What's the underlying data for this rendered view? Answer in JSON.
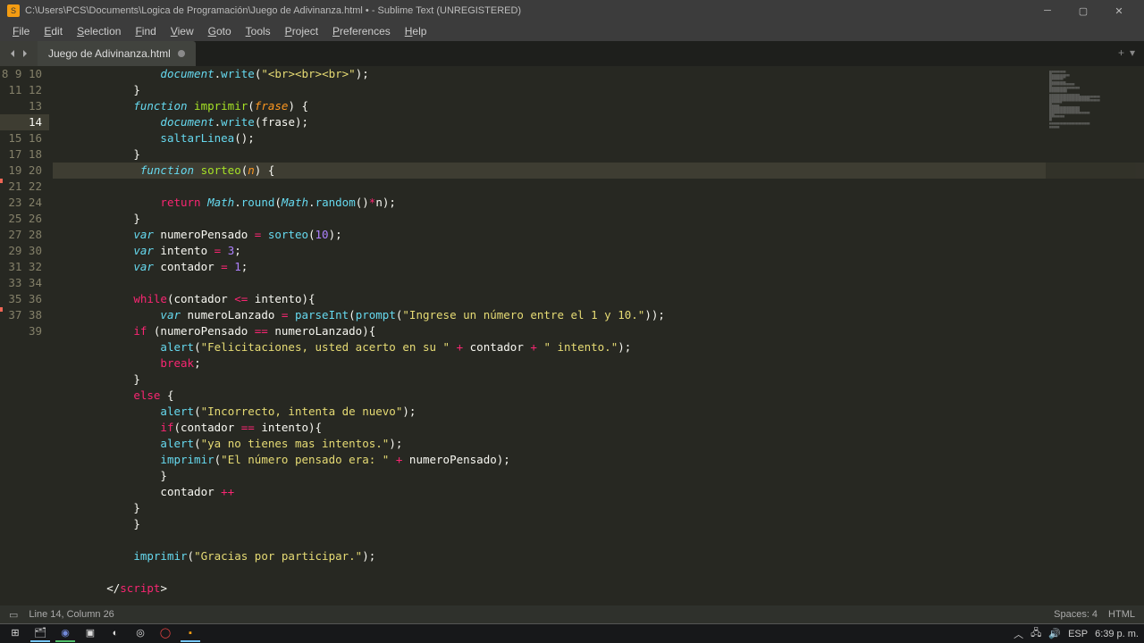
{
  "window": {
    "title": "C:\\Users\\PCS\\Documents\\Logica de Programación\\Juego de Adivinanza.html • - Sublime Text (UNREGISTERED)"
  },
  "menu": {
    "items": [
      "File",
      "Edit",
      "Selection",
      "Find",
      "View",
      "Goto",
      "Tools",
      "Project",
      "Preferences",
      "Help"
    ]
  },
  "tab": {
    "title": "Juego de Adivinanza.html"
  },
  "gutter": {
    "start": 8,
    "end": 39,
    "highlight": 14
  },
  "status": {
    "cursor": "Line 14, Column 26",
    "spaces": "Spaces: 4",
    "syntax": "HTML"
  },
  "taskbar": {
    "lang": "ESP",
    "time": "6:39 p. m."
  },
  "code_lines": [
    {
      "n": 8,
      "indent": 16,
      "seg": [
        {
          "c": "c-obj",
          "t": "document"
        },
        {
          "c": "c-pn",
          "t": "."
        },
        {
          "c": "c-mth",
          "t": "write"
        },
        {
          "c": "c-pn",
          "t": "("
        },
        {
          "c": "c-str",
          "t": "\"<br><br><br>\""
        },
        {
          "c": "c-pn",
          "t": ");"
        }
      ]
    },
    {
      "n": 9,
      "indent": 12,
      "seg": [
        {
          "c": "c-pn",
          "t": "}"
        }
      ]
    },
    {
      "n": 10,
      "indent": 12,
      "seg": [
        {
          "c": "c-stor",
          "t": "function "
        },
        {
          "c": "c-fn",
          "t": "imprimir"
        },
        {
          "c": "c-pn",
          "t": "("
        },
        {
          "c": "c-param",
          "t": "frase"
        },
        {
          "c": "c-pn",
          "t": ") {"
        }
      ]
    },
    {
      "n": 11,
      "indent": 16,
      "seg": [
        {
          "c": "c-obj",
          "t": "document"
        },
        {
          "c": "c-pn",
          "t": "."
        },
        {
          "c": "c-mth",
          "t": "write"
        },
        {
          "c": "c-pn",
          "t": "("
        },
        {
          "c": "c-var",
          "t": "frase"
        },
        {
          "c": "c-pn",
          "t": ");"
        }
      ]
    },
    {
      "n": 12,
      "indent": 16,
      "seg": [
        {
          "c": "c-mth",
          "t": "saltarLinea"
        },
        {
          "c": "c-pn",
          "t": "();"
        }
      ]
    },
    {
      "n": 13,
      "indent": 12,
      "seg": [
        {
          "c": "c-pn",
          "t": "}"
        }
      ]
    },
    {
      "n": 14,
      "indent": 12,
      "hl": true,
      "seg": [
        {
          "c": "c-stor",
          "t": " function "
        },
        {
          "c": "c-fn",
          "t": "sorteo"
        },
        {
          "c": "c-pn",
          "t": "("
        },
        {
          "c": "c-param",
          "t": "n"
        },
        {
          "c": "c-pn",
          "t": ") {"
        }
      ]
    },
    {
      "n": 15,
      "indent": 16,
      "seg": [
        {
          "c": "c-kw2",
          "t": "return "
        },
        {
          "c": "c-obj",
          "t": "Math"
        },
        {
          "c": "c-pn",
          "t": "."
        },
        {
          "c": "c-mth",
          "t": "round"
        },
        {
          "c": "c-pn",
          "t": "("
        },
        {
          "c": "c-obj",
          "t": "Math"
        },
        {
          "c": "c-pn",
          "t": "."
        },
        {
          "c": "c-mth",
          "t": "random"
        },
        {
          "c": "c-pn",
          "t": "()"
        },
        {
          "c": "c-op",
          "t": "*"
        },
        {
          "c": "c-var",
          "t": "n"
        },
        {
          "c": "c-pn",
          "t": ");"
        }
      ]
    },
    {
      "n": 16,
      "indent": 12,
      "seg": [
        {
          "c": "c-pn",
          "t": "}"
        }
      ]
    },
    {
      "n": 17,
      "indent": 12,
      "seg": [
        {
          "c": "c-stor",
          "t": "var "
        },
        {
          "c": "c-var",
          "t": "numeroPensado "
        },
        {
          "c": "c-op",
          "t": "= "
        },
        {
          "c": "c-mth",
          "t": "sorteo"
        },
        {
          "c": "c-pn",
          "t": "("
        },
        {
          "c": "c-num",
          "t": "10"
        },
        {
          "c": "c-pn",
          "t": ");"
        }
      ]
    },
    {
      "n": 18,
      "indent": 12,
      "seg": [
        {
          "c": "c-stor",
          "t": "var "
        },
        {
          "c": "c-var",
          "t": "intento "
        },
        {
          "c": "c-op",
          "t": "= "
        },
        {
          "c": "c-num",
          "t": "3"
        },
        {
          "c": "c-pn",
          "t": ";"
        }
      ]
    },
    {
      "n": 19,
      "indent": 12,
      "seg": [
        {
          "c": "c-stor",
          "t": "var "
        },
        {
          "c": "c-var",
          "t": "contador "
        },
        {
          "c": "c-op",
          "t": "= "
        },
        {
          "c": "c-num",
          "t": "1"
        },
        {
          "c": "c-pn",
          "t": ";"
        }
      ]
    },
    {
      "n": 20,
      "indent": 0,
      "seg": []
    },
    {
      "n": 21,
      "indent": 12,
      "seg": [
        {
          "c": "c-kw2",
          "t": "while"
        },
        {
          "c": "c-pn",
          "t": "("
        },
        {
          "c": "c-var",
          "t": "contador "
        },
        {
          "c": "c-op",
          "t": "<= "
        },
        {
          "c": "c-var",
          "t": "intento"
        },
        {
          "c": "c-pn",
          "t": "){"
        }
      ]
    },
    {
      "n": 22,
      "indent": 16,
      "seg": [
        {
          "c": "c-stor",
          "t": "var "
        },
        {
          "c": "c-var",
          "t": "numeroLanzado "
        },
        {
          "c": "c-op",
          "t": "= "
        },
        {
          "c": "c-mth",
          "t": "parseInt"
        },
        {
          "c": "c-pn",
          "t": "("
        },
        {
          "c": "c-mth",
          "t": "prompt"
        },
        {
          "c": "c-pn",
          "t": "("
        },
        {
          "c": "c-str",
          "t": "\"Ingrese un número entre el 1 y 10.\""
        },
        {
          "c": "c-pn",
          "t": "));"
        }
      ]
    },
    {
      "n": 23,
      "indent": 12,
      "seg": [
        {
          "c": "c-kw2",
          "t": "if "
        },
        {
          "c": "c-pn",
          "t": "("
        },
        {
          "c": "c-var",
          "t": "numeroPensado "
        },
        {
          "c": "c-op",
          "t": "== "
        },
        {
          "c": "c-var",
          "t": "numeroLanzado"
        },
        {
          "c": "c-pn",
          "t": "){"
        }
      ]
    },
    {
      "n": 24,
      "indent": 16,
      "seg": [
        {
          "c": "c-mth",
          "t": "alert"
        },
        {
          "c": "c-pn",
          "t": "("
        },
        {
          "c": "c-str",
          "t": "\"Felicitaciones, usted acerto en su \""
        },
        {
          "c": "c-var",
          "t": " "
        },
        {
          "c": "c-op",
          "t": "+ "
        },
        {
          "c": "c-var",
          "t": "contador "
        },
        {
          "c": "c-op",
          "t": "+ "
        },
        {
          "c": "c-str",
          "t": "\" intento.\""
        },
        {
          "c": "c-pn",
          "t": ");"
        }
      ]
    },
    {
      "n": 25,
      "indent": 16,
      "seg": [
        {
          "c": "c-kw2",
          "t": "break"
        },
        {
          "c": "c-pn",
          "t": ";"
        }
      ]
    },
    {
      "n": 26,
      "indent": 12,
      "seg": [
        {
          "c": "c-pn",
          "t": "}"
        }
      ]
    },
    {
      "n": 27,
      "indent": 12,
      "seg": [
        {
          "c": "c-kw2",
          "t": "else "
        },
        {
          "c": "c-pn",
          "t": "{"
        }
      ]
    },
    {
      "n": 28,
      "indent": 16,
      "seg": [
        {
          "c": "c-mth",
          "t": "alert"
        },
        {
          "c": "c-pn",
          "t": "("
        },
        {
          "c": "c-str",
          "t": "\"Incorrecto, intenta de nuevo\""
        },
        {
          "c": "c-pn",
          "t": ");"
        }
      ]
    },
    {
      "n": 29,
      "indent": 16,
      "seg": [
        {
          "c": "c-kw2",
          "t": "if"
        },
        {
          "c": "c-pn",
          "t": "("
        },
        {
          "c": "c-var",
          "t": "contador "
        },
        {
          "c": "c-op",
          "t": "== "
        },
        {
          "c": "c-var",
          "t": "intento"
        },
        {
          "c": "c-pn",
          "t": "){"
        }
      ]
    },
    {
      "n": 30,
      "indent": 16,
      "seg": [
        {
          "c": "c-mth",
          "t": "alert"
        },
        {
          "c": "c-pn",
          "t": "("
        },
        {
          "c": "c-str",
          "t": "\"ya no tienes mas intentos.\""
        },
        {
          "c": "c-pn",
          "t": ");"
        }
      ]
    },
    {
      "n": 31,
      "indent": 16,
      "seg": [
        {
          "c": "c-mth",
          "t": "imprimir"
        },
        {
          "c": "c-pn",
          "t": "("
        },
        {
          "c": "c-str",
          "t": "\"El número pensado era: \""
        },
        {
          "c": "c-var",
          "t": " "
        },
        {
          "c": "c-op",
          "t": "+ "
        },
        {
          "c": "c-var",
          "t": "numeroPensado"
        },
        {
          "c": "c-pn",
          "t": ");"
        }
      ]
    },
    {
      "n": 32,
      "indent": 16,
      "seg": [
        {
          "c": "c-pn",
          "t": "}"
        }
      ]
    },
    {
      "n": 33,
      "indent": 16,
      "seg": [
        {
          "c": "c-var",
          "t": "contador "
        },
        {
          "c": "c-op",
          "t": "++"
        }
      ]
    },
    {
      "n": 34,
      "indent": 12,
      "seg": [
        {
          "c": "c-pn",
          "t": "}"
        }
      ]
    },
    {
      "n": 35,
      "indent": 12,
      "seg": [
        {
          "c": "c-pn",
          "t": "}"
        }
      ]
    },
    {
      "n": 36,
      "indent": 0,
      "seg": []
    },
    {
      "n": 37,
      "indent": 12,
      "seg": [
        {
          "c": "c-mth",
          "t": "imprimir"
        },
        {
          "c": "c-pn",
          "t": "("
        },
        {
          "c": "c-str",
          "t": "\"Gracias por participar.\""
        },
        {
          "c": "c-pn",
          "t": ");"
        }
      ]
    },
    {
      "n": 38,
      "indent": 0,
      "seg": []
    },
    {
      "n": 39,
      "indent": 8,
      "seg": [
        {
          "c": "c-pn",
          "t": "</"
        },
        {
          "c": "c-tag",
          "t": "script"
        },
        {
          "c": "c-pn",
          "t": ">"
        }
      ]
    }
  ]
}
